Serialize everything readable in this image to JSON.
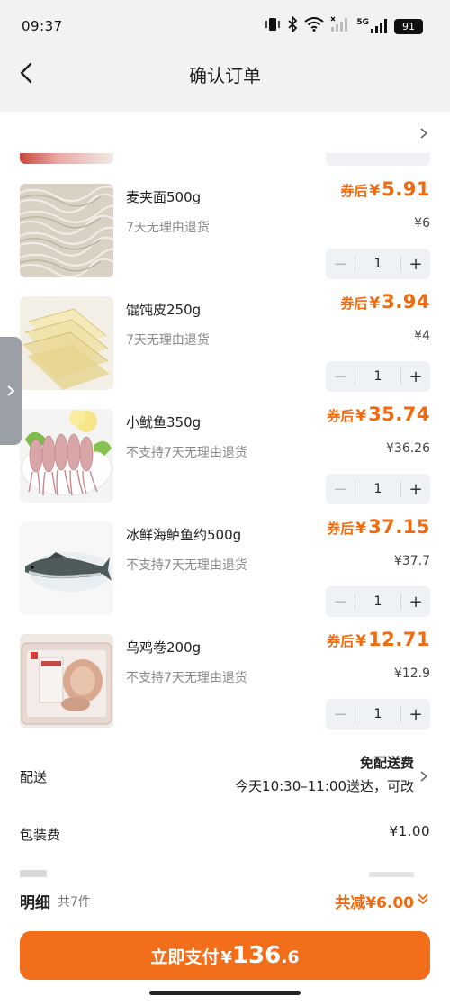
{
  "status_bar": {
    "time": "09:37",
    "network": "5G",
    "battery": "91"
  },
  "header": {
    "title": "确认订单"
  },
  "items": [
    {
      "name": "麦夹面500g",
      "policy": "7天无理由退货",
      "coupon_label": "券后",
      "currency": "¥",
      "coupon_price": "5.91",
      "original_price": "¥6",
      "quantity": "1",
      "thumb": "noodles"
    },
    {
      "name": "馄饨皮250g",
      "policy": "7天无理由退货",
      "coupon_label": "券后",
      "currency": "¥",
      "coupon_price": "3.94",
      "original_price": "¥4",
      "quantity": "1",
      "thumb": "wonton-wrappers"
    },
    {
      "name": "小鱿鱼350g",
      "policy": "不支持7天无理由退货",
      "coupon_label": "券后",
      "currency": "¥",
      "coupon_price": "35.74",
      "original_price": "¥36.26",
      "quantity": "1",
      "thumb": "squid"
    },
    {
      "name": "冰鲜海鲈鱼约500g",
      "policy": "不支持7天无理由退货",
      "coupon_label": "券后",
      "currency": "¥",
      "coupon_price": "37.15",
      "original_price": "¥37.7",
      "quantity": "1",
      "thumb": "sea-bass"
    },
    {
      "name": "乌鸡卷200g",
      "policy": "不支持7天无理由退货",
      "coupon_label": "券后",
      "currency": "¥",
      "coupon_price": "12.71",
      "original_price": "¥12.9",
      "quantity": "1",
      "thumb": "chicken-roll"
    }
  ],
  "delivery": {
    "label": "配送",
    "fee_text": "免配送费",
    "time_text": "今天10:30–11:00送达，可改"
  },
  "packing": {
    "label": "包装费",
    "fee": "¥1.00"
  },
  "summary": {
    "label": "明细",
    "count": "共7件",
    "discount": "共减¥6.00"
  },
  "pay": {
    "label": "立即支付",
    "currency": "¥",
    "amount_int": "136",
    "amount_dec": ".6"
  },
  "colors": {
    "accent": "#f36e1b",
    "price": "#f06a10",
    "header_bg": "#f2f2f2",
    "stepper_bg": "#eef2f5"
  }
}
